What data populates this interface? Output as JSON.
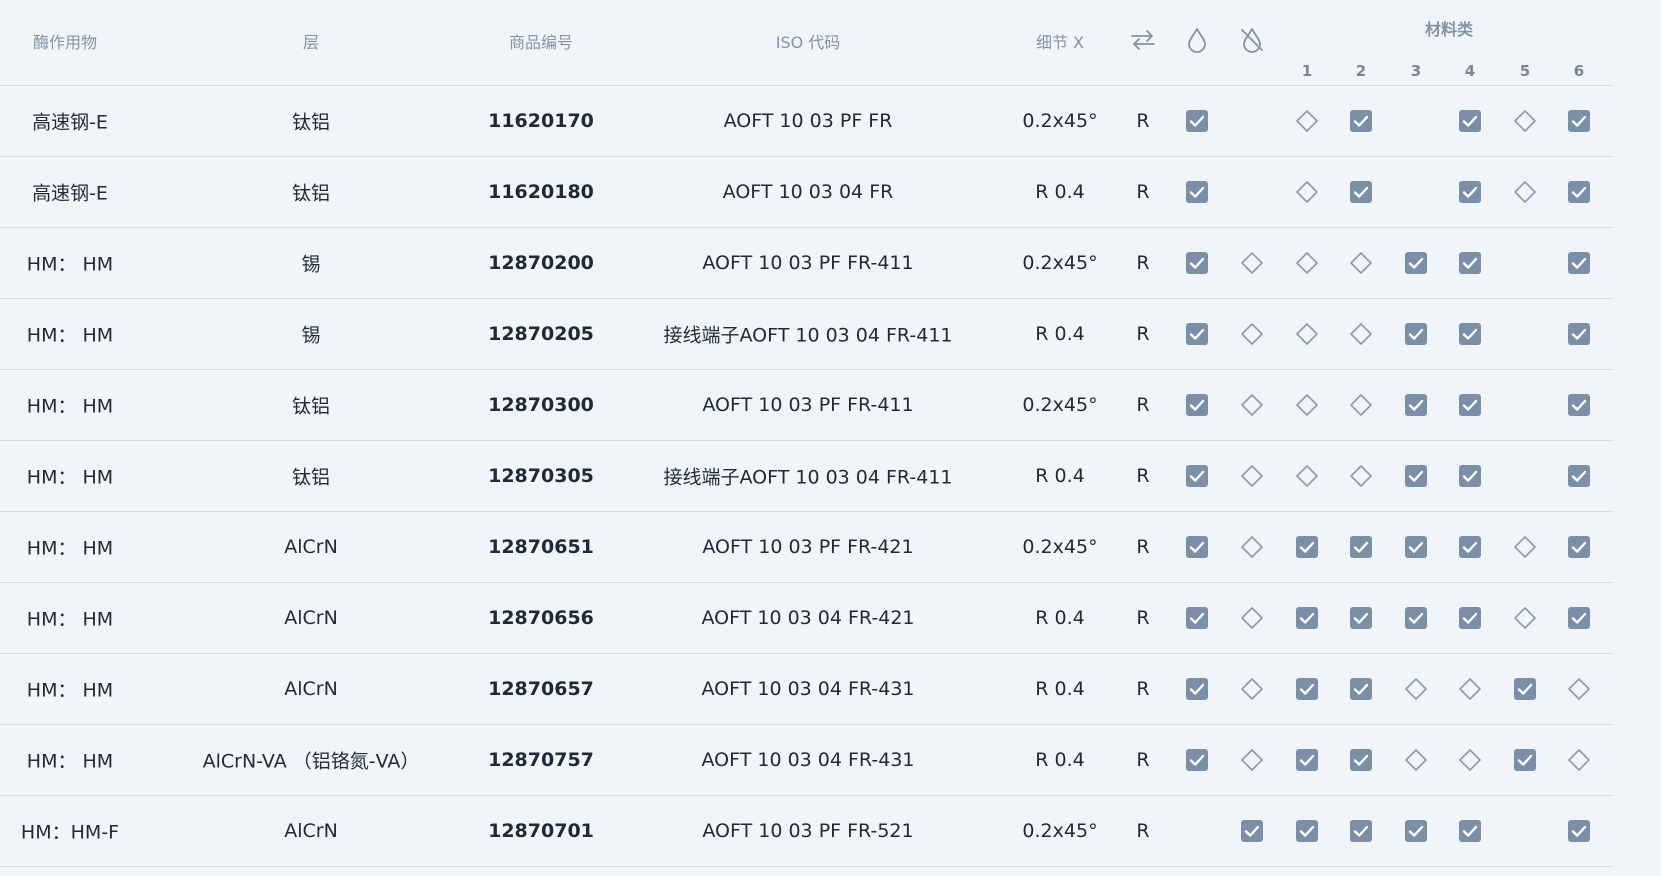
{
  "header": {
    "application": "酶作用物",
    "layer": "层",
    "article_no": "商品编号",
    "iso_code": "ISO 代码",
    "detail": "细节 X",
    "material_group": "材料类",
    "material_numbers": [
      "1",
      "2",
      "3",
      "4",
      "5",
      "6"
    ],
    "icons": [
      "swap-arrows-icon",
      "drop-icon",
      "no-drop-icon"
    ]
  },
  "rows": [
    {
      "app": "高速钢-E",
      "layer": "钛铝",
      "article": "11620170",
      "iso": "AOFT 10 03 PF FR",
      "detail": "0.2x45°",
      "dir": "R",
      "marks": [
        "check",
        "none",
        "diamond",
        "check",
        "none",
        "check",
        "diamond",
        "check"
      ]
    },
    {
      "app": "高速钢-E",
      "layer": "钛铝",
      "article": "11620180",
      "iso": "AOFT 10 03 04 FR",
      "detail": "R 0.4",
      "dir": "R",
      "marks": [
        "check",
        "none",
        "diamond",
        "check",
        "none",
        "check",
        "diamond",
        "check"
      ]
    },
    {
      "app": "HM： HM",
      "layer": "锡",
      "article": "12870200",
      "iso": "AOFT 10 03 PF FR-411",
      "detail": "0.2x45°",
      "dir": "R",
      "marks": [
        "check",
        "diamond",
        "diamond",
        "diamond",
        "check",
        "check",
        "none",
        "check"
      ]
    },
    {
      "app": "HM： HM",
      "layer": "锡",
      "article": "12870205",
      "iso": "接线端子AOFT 10 03 04 FR-411",
      "detail": "R 0.4",
      "dir": "R",
      "marks": [
        "check",
        "diamond",
        "diamond",
        "diamond",
        "check",
        "check",
        "none",
        "check"
      ]
    },
    {
      "app": "HM： HM",
      "layer": "钛铝",
      "article": "12870300",
      "iso": "AOFT 10 03 PF FR-411",
      "detail": "0.2x45°",
      "dir": "R",
      "marks": [
        "check",
        "diamond",
        "diamond",
        "diamond",
        "check",
        "check",
        "none",
        "check"
      ]
    },
    {
      "app": "HM： HM",
      "layer": "钛铝",
      "article": "12870305",
      "iso": "接线端子AOFT 10 03 04 FR-411",
      "detail": "R 0.4",
      "dir": "R",
      "marks": [
        "check",
        "diamond",
        "diamond",
        "diamond",
        "check",
        "check",
        "none",
        "check"
      ]
    },
    {
      "app": "HM： HM",
      "layer": "AlCrN",
      "article": "12870651",
      "iso": "AOFT 10 03 PF FR-421",
      "detail": "0.2x45°",
      "dir": "R",
      "marks": [
        "check",
        "diamond",
        "check",
        "check",
        "check",
        "check",
        "diamond",
        "check"
      ]
    },
    {
      "app": "HM： HM",
      "layer": "AlCrN",
      "article": "12870656",
      "iso": "AOFT 10 03 04 FR-421",
      "detail": "R 0.4",
      "dir": "R",
      "marks": [
        "check",
        "diamond",
        "check",
        "check",
        "check",
        "check",
        "diamond",
        "check"
      ]
    },
    {
      "app": "HM： HM",
      "layer": "AlCrN",
      "article": "12870657",
      "iso": "AOFT 10 03 04 FR-431",
      "detail": "R 0.4",
      "dir": "R",
      "marks": [
        "check",
        "diamond",
        "check",
        "check",
        "diamond",
        "diamond",
        "check",
        "diamond"
      ]
    },
    {
      "app": "HM： HM",
      "layer": "AlCrN-VA （铝铬氮-VA）",
      "article": "12870757",
      "iso": "AOFT 10 03 04 FR-431",
      "detail": "R 0.4",
      "dir": "R",
      "marks": [
        "check",
        "diamond",
        "check",
        "check",
        "diamond",
        "diamond",
        "check",
        "diamond"
      ]
    },
    {
      "app": "HM：HM-F",
      "layer": "AlCrN",
      "article": "12870701",
      "iso": "AOFT 10 03 PF FR-521",
      "detail": "0.2x45°",
      "dir": "R",
      "marks": [
        "none",
        "check",
        "check",
        "check",
        "check",
        "check",
        "none",
        "check"
      ]
    }
  ],
  "colors": {
    "check_fill": "#7b8fa6",
    "diamond_stroke": "#8a9bb0",
    "background": "#f1f4f9",
    "divider": "#d9dee6"
  }
}
